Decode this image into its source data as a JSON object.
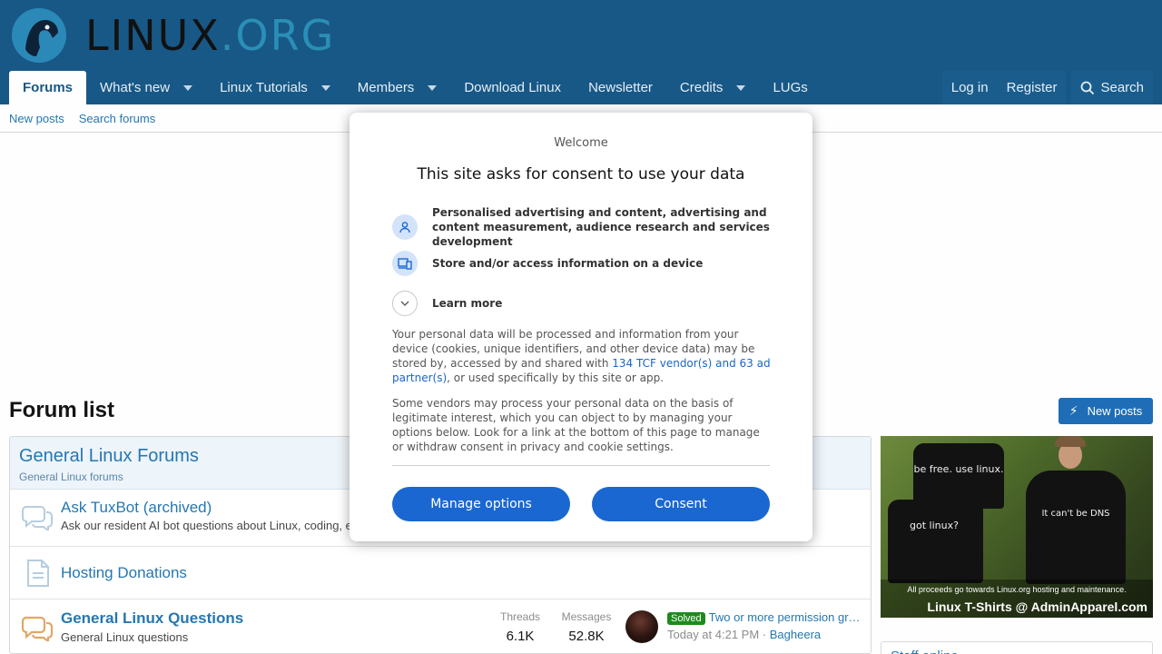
{
  "header": {
    "logo_text_1": "LINUX",
    "logo_text_2": ".ORG",
    "nav": [
      {
        "label": "Forums"
      },
      {
        "label": "What's new"
      },
      {
        "label": "Linux Tutorials"
      },
      {
        "label": "Members"
      },
      {
        "label": "Download Linux"
      },
      {
        "label": "Newsletter"
      },
      {
        "label": "Credits"
      },
      {
        "label": "LUGs"
      }
    ],
    "login": "Log in",
    "register": "Register",
    "search": "Search"
  },
  "subnav": {
    "new_posts": "New posts",
    "search_forums": "Search forums"
  },
  "main": {
    "title": "Forum list",
    "new_posts_button": "New posts",
    "category": {
      "title": "General Linux Forums",
      "description": "General Linux forums"
    },
    "nodes": [
      {
        "title": "Ask TuxBot (archived)",
        "description": "Ask our resident AI bot questions about Linux, coding, e"
      },
      {
        "title": "Hosting Donations"
      },
      {
        "title": "General Linux Questions",
        "description": "General Linux questions",
        "threads_label": "Threads",
        "threads_value": "6.1K",
        "messages_label": "Messages",
        "messages_value": "52.8K",
        "latest_badge": "Solved",
        "latest_title": "Two or more permission gr…",
        "latest_time": "Today at 4:21 PM",
        "latest_sep": "·",
        "latest_user": "Bagheera"
      }
    ]
  },
  "sidebar": {
    "ad": {
      "shirt_1": "be free. use linux.",
      "shirt_2": "got linux?",
      "shirt_3": "It can't be DNS",
      "footer_1": "All proceeds go towards Linux.org hosting and maintenance.",
      "footer_2": "Linux T-Shirts @ AdminApparel.com"
    },
    "next_block_title": "Staff online"
  },
  "consent": {
    "welcome": "Welcome",
    "title": "This site asks for consent to use your data",
    "purpose_1": "Personalised advertising and content, advertising and content measurement, audience research and services development",
    "purpose_2": "Store and/or access information on a device",
    "learn_more": "Learn more",
    "para_1_a": "Your personal data will be processed and information from your device (cookies, unique identifiers, and other device data) may be stored by, accessed by and shared with ",
    "para_1_link": "134 TCF vendor(s) and 63 ad partner(s)",
    "para_1_b": ", or used specifically by this site or app.",
    "para_2": "Some vendors may process your personal data on the basis of legitimate interest, which you can object to by managing your options below. Look for a link at the bottom of this page to manage or withdraw consent in privacy and cookie settings.",
    "manage_options": "Manage options",
    "consent_button": "Consent"
  },
  "colors": {
    "header_bg": "#185886",
    "link": "#2577b1",
    "consent_button": "#1a67d2",
    "solved_badge": "#1e8a1e"
  }
}
